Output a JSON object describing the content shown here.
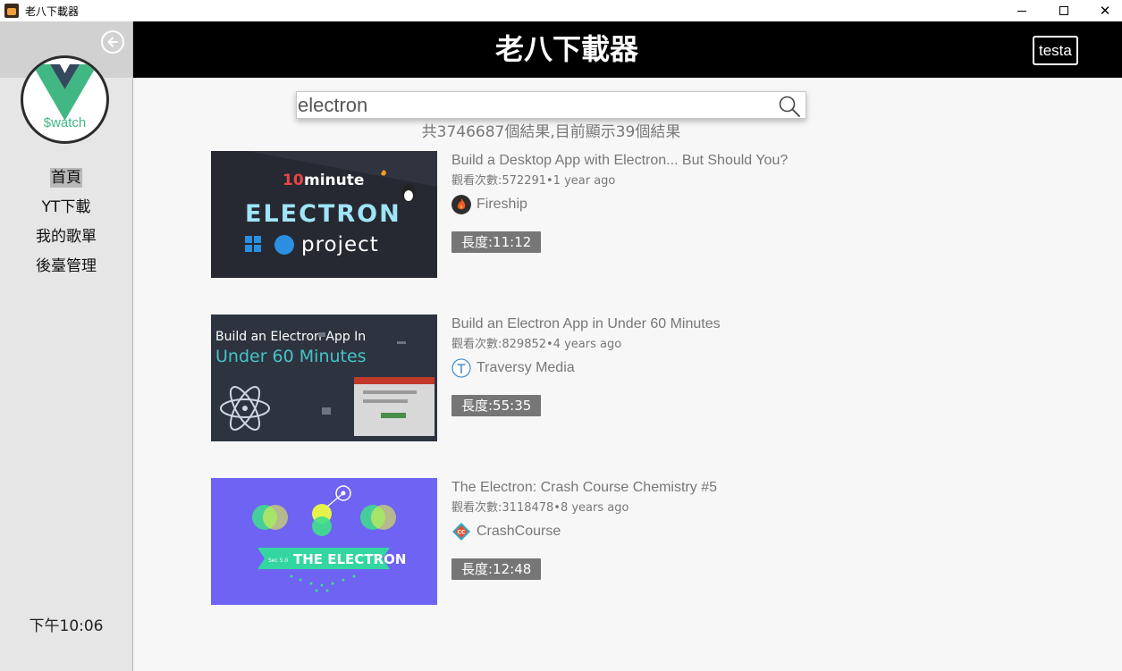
{
  "window": {
    "title": "老八下載器"
  },
  "header": {
    "title": "老八下載器",
    "user": "testa"
  },
  "sidebar": {
    "avatar_text": "$watch",
    "nav": [
      {
        "label": "首頁",
        "active": true
      },
      {
        "label": "YT下載",
        "active": false
      },
      {
        "label": "我的歌單",
        "active": false
      },
      {
        "label": "後臺管理",
        "active": false
      }
    ],
    "clock": "下午10:06"
  },
  "search": {
    "query": "electron",
    "result_count": "共3746687個結果,目前顯示39個結果"
  },
  "videos": [
    {
      "title": "Build a Desktop App with Electron... But Should You?",
      "meta": "觀看次數:572291•1 year ago",
      "channel": "Fireship",
      "duration": "長度:11:12",
      "thumb": {
        "line1a": "10",
        "line1b": "minute",
        "line2": "ELECTRON",
        "line3": "project"
      }
    },
    {
      "title": "Build an Electron App in Under 60 Minutes",
      "meta": "觀看次數:829852•4 years ago",
      "channel": "Traversy Media",
      "duration": "長度:55:35",
      "thumb": {
        "line1": "Build an Electron App In",
        "line2": "Under 60 Minutes"
      }
    },
    {
      "title": "The Electron: Crash Course Chemistry #5",
      "meta": "觀看次數:3118478•8 years ago",
      "channel": "CrashCourse",
      "duration": "長度:12:48",
      "thumb": {
        "banner": "THE ELECTRON",
        "small": "Sec 5.0"
      }
    }
  ],
  "colors": {
    "header_bg": "#000000",
    "sidebar_bg": "#e6e6e6",
    "content_bg": "#f7f7f7",
    "duration_badge": "#767676",
    "vue_green": "#41b883",
    "vue_dark": "#35495e"
  }
}
